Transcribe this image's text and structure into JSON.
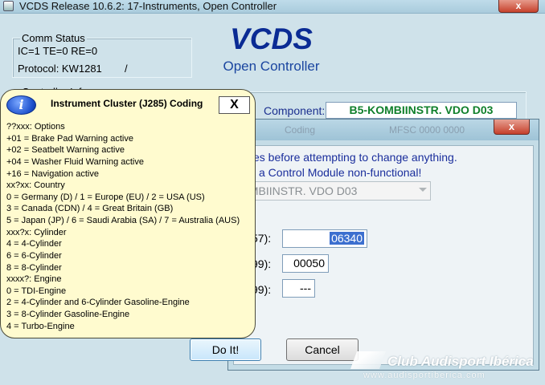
{
  "window": {
    "title": "VCDS Release 10.6.2: 17-Instruments,  Open Controller",
    "close_glyph": "x"
  },
  "comm_status": {
    "title": "Comm Status",
    "line1": "IC=1  TE=0   RE=0",
    "protocol": "Protocol: KW1281",
    "indicator": "/"
  },
  "header": {
    "logo": "VCDS",
    "subtitle": "Open Controller"
  },
  "controller_info": {
    "title": "Controller Info",
    "component_label": "Component:",
    "component_value": "B5-KOMBIINSTR. VDO D03"
  },
  "dialog": {
    "title_left": "Coding",
    "title_right": "MFSC 0000 0000",
    "close_glyph": "x",
    "warning_line1": "es before attempting to change anything.",
    "warning_line2": "a Control Module non-functional!",
    "combo_value": "OMBIINSTR. VDO D03",
    "field1_label": "57):",
    "field1_value": "06340",
    "field2_label": "99):",
    "field2_value": "00050",
    "field3_label": "99):",
    "field3_value": "---",
    "do_it_label": "Do It!",
    "cancel_label": "Cancel"
  },
  "info_bubble": {
    "icon_glyph": "i",
    "title": "Instrument Cluster (J285) Coding",
    "close_glyph": "X",
    "lines": [
      "??xxx: Options",
      "+01 = Brake Pad Warning active",
      "+02 = Seatbelt Warning active",
      "+04 = Washer Fluid Warning active",
      "+16 = Navigation active",
      "xx?xx: Country",
      "0 = Germany (D) / 1 = Europe (EU) / 2 = USA (US)",
      "3 = Canada (CDN) / 4 = Great Britain (GB)",
      "5 = Japan (JP) / 6 = Saudi Arabia (SA) / 7 = Australia (AUS)",
      "xxx?x: Cylinder",
      "4 = 4-Cylinder",
      "6 = 6-Cylinder",
      "8 = 8-Cylinder",
      "xxxx?: Engine",
      "0 = TDI-Engine",
      "2 = 4-Cylinder and 6-Cylinder Gasoline-Engine",
      "3 = 8-Cylinder Gasoline-Engine",
      "4 = Turbo-Engine"
    ]
  },
  "watermark": {
    "text": "Club Audisport Ibérica",
    "url": "www.audisportiberica.com"
  }
}
